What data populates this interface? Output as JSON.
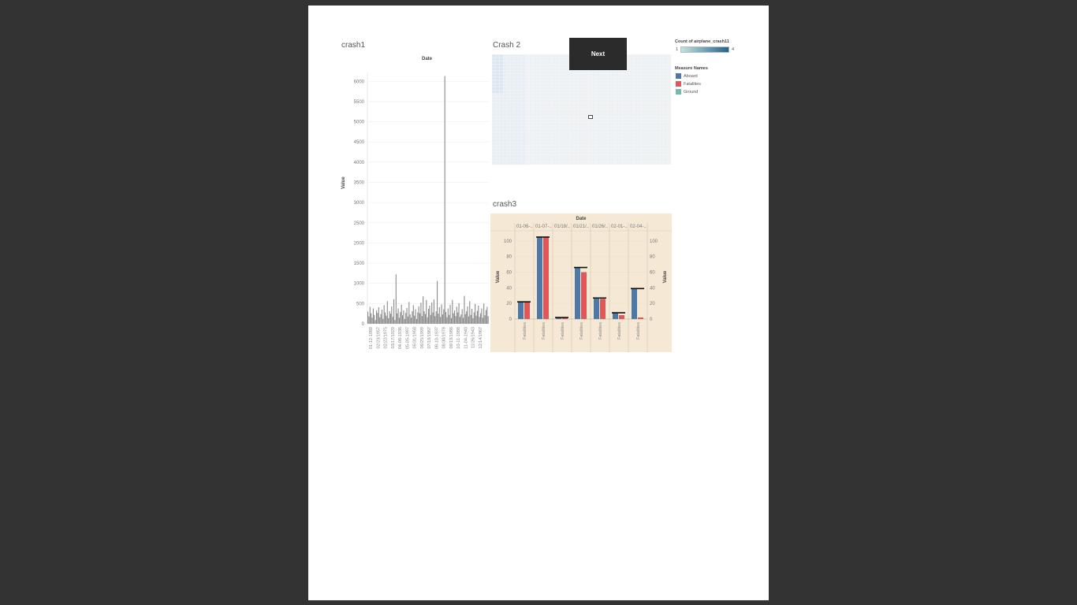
{
  "next_button": {
    "label": "Next"
  },
  "crash1": {
    "title": "crash1",
    "chart_data": {
      "type": "bar",
      "title": "crash1",
      "xlabel": "Date",
      "ylabel": "Value",
      "ylim": [
        0,
        6200
      ],
      "yticks": [
        0,
        500,
        1000,
        1500,
        2000,
        2500,
        3000,
        3500,
        4000,
        4500,
        5000,
        5500,
        6000
      ],
      "xtick_labels": [
        "01-12-1989",
        "02/23/1957",
        "02/22/1975",
        "03/17/1929",
        "04-08-1936",
        "05-05-1997",
        "05/31/1958",
        "06/25/1999",
        "07/19/1967",
        "08-10-1937",
        "08/30/1978",
        "09/19/1986",
        "10-11-1988",
        "11-04-1940",
        "11/26/1943",
        "12/14/1967"
      ],
      "bar_color": "#8a8a8a",
      "values": [
        300,
        180,
        420,
        260,
        150,
        380,
        220,
        90,
        330,
        270,
        410,
        160,
        240,
        350,
        120,
        460,
        280,
        200,
        560,
        140,
        310,
        250,
        430,
        170,
        610,
        90,
        1220,
        260,
        380,
        150,
        290,
        470,
        210,
        330,
        120,
        270,
        390,
        180,
        540,
        230,
        150,
        310,
        460,
        200,
        360,
        120,
        280,
        430,
        260,
        520,
        190,
        680,
        310,
        240,
        590,
        160,
        370,
        450,
        220,
        530,
        280,
        600,
        190,
        310,
        1060,
        250,
        410,
        170,
        480,
        230,
        360,
        6130,
        290,
        160,
        380,
        220,
        470,
        140,
        590,
        260,
        330,
        190,
        420,
        280,
        510,
        170,
        230,
        360,
        150,
        690,
        240,
        310,
        430,
        180,
        560,
        220,
        370,
        140,
        280,
        490,
        200,
        320,
        450,
        170,
        260,
        380,
        150,
        500,
        210,
        340,
        420,
        190
      ]
    }
  },
  "crash2": {
    "title": "Crash 2",
    "chart_data": {
      "type": "heatmap",
      "title": "Crash 2",
      "color_scale": {
        "title": "Count of airplane_crash11",
        "min": 1,
        "max": 4,
        "colors": [
          "#c3e2e0",
          "#24628e"
        ]
      }
    }
  },
  "legend": {
    "color_title": "Count of airplane_crash11",
    "color_min": "1",
    "color_max": "4",
    "measure_title": "Measure Names",
    "items": [
      {
        "label": "Aboard",
        "color": "#4e79a7"
      },
      {
        "label": "Fatalities",
        "color": "#e15759"
      },
      {
        "label": "Ground",
        "color": "#76b7b2"
      }
    ]
  },
  "crash3": {
    "title": "crash3",
    "chart_data": {
      "type": "bar",
      "title": "crash3",
      "xlabel": "Date",
      "ylabel": "Value",
      "ylim": [
        0,
        108
      ],
      "yticks": [
        0,
        20,
        40,
        60,
        80,
        100
      ],
      "categories": [
        "01-06-..",
        "01-07-..",
        "01/18/..",
        "01/21/..",
        "01/26/..",
        "02-01-..",
        "02-04-.."
      ],
      "row_labels": [
        "Fatalities",
        "Fatalities",
        "Fatalities",
        "Fatalities",
        "Fatalities",
        "Fatalities",
        "Fatalities"
      ],
      "background": "#f5e9d6",
      "series": [
        {
          "name": "Aboard",
          "color": "#4e79a7",
          "values": [
            22,
            105,
            2,
            66,
            27,
            8,
            39
          ]
        },
        {
          "name": "Fatalities",
          "color": "#e15759",
          "values": [
            22,
            105,
            2,
            60,
            26,
            5,
            2
          ]
        }
      ]
    }
  }
}
